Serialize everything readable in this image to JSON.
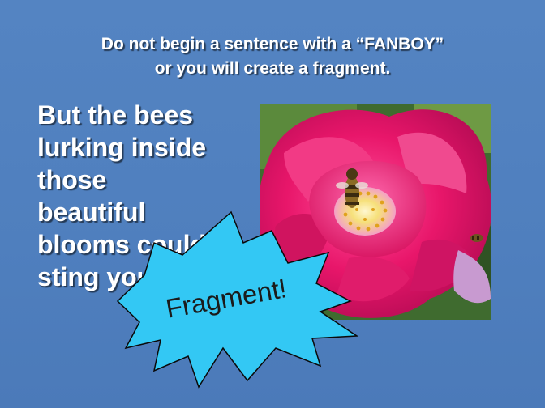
{
  "slide": {
    "title_line1": "Do not begin a sentence with a “FANBOY”",
    "title_line2": "or you will create a fragment.",
    "body_lines": [
      "But the bees",
      "lurking inside",
      "those",
      "beautiful",
      "blooms could",
      "sting you."
    ],
    "callout": "Fragment!"
  },
  "colors": {
    "background": "#5080bf",
    "text": "#ffffff",
    "burst_fill": "#33c8f4",
    "rose": "#e8166a"
  },
  "image": {
    "subject": "pink rose with a bee"
  }
}
